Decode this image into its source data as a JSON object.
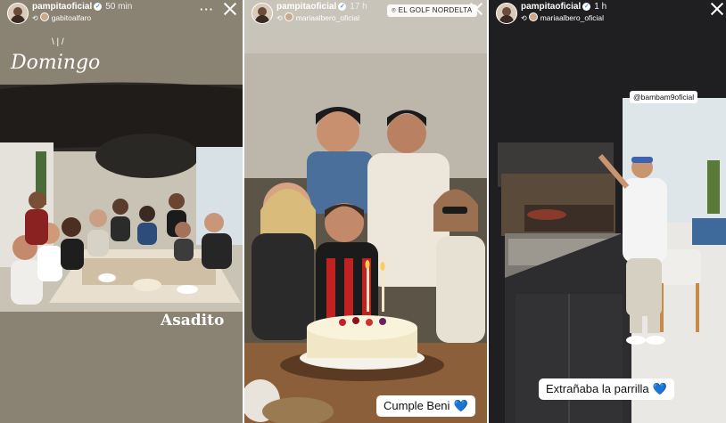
{
  "stories": [
    {
      "username": "pampitaoficial",
      "time": "50 min",
      "reposted_from": "gabitoalfaro",
      "text_overlays": [
        "Domingo",
        "Asadito"
      ],
      "more_icon": "more-dots-icon",
      "close_icon": "close-icon"
    },
    {
      "username": "pampitaoficial",
      "time": "17 h",
      "reposted_from": "mariaalbero_oficial",
      "location": "EL GOLF NORDELTA",
      "sticker": "Cumple Beni",
      "heart": "💙"
    },
    {
      "username": "pampitaoficial",
      "time": "1 h",
      "reposted_from": "mariaalbero_oficial",
      "mention": "@bambam9oficial",
      "sticker": "Extrañaba la parrilla",
      "heart": "💙"
    }
  ],
  "verified_glyph": "✓",
  "repost_glyph": "⟲",
  "more_glyph": "···"
}
